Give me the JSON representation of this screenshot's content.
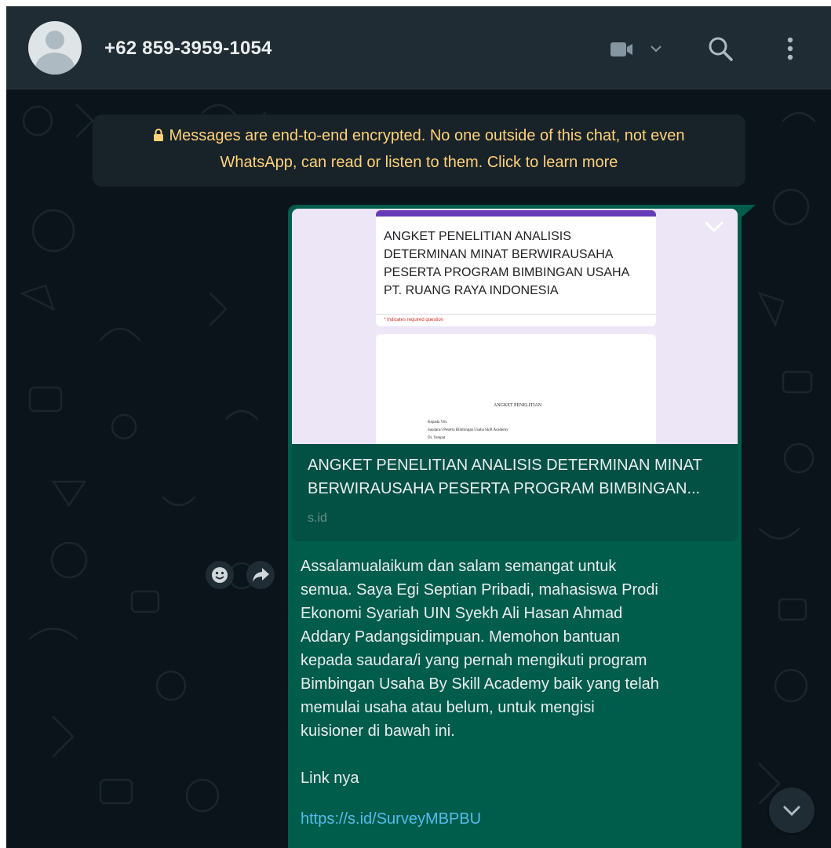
{
  "header": {
    "contact_name": "+62 859-3959-1054",
    "icons": [
      "default-avatar-icon",
      "video-call-icon",
      "chevron-down-icon",
      "search-icon",
      "menu-dots-icon"
    ]
  },
  "encryption_notice": {
    "line1": "Messages are end-to-end encrypted. No one outside of this chat, not even",
    "line2": "WhatsApp, can read or listen to them. Click to learn more",
    "color": "#ffd279"
  },
  "message": {
    "preview": {
      "form_title_lines": [
        "ANGKET PENELITIAN ANALISIS",
        "DETERMINAN MINAT BERWIRAUSAHA",
        "PESERTA PROGRAM BIMBINGAN USAHA",
        "PT. RUANG RAYA INDONESIA"
      ],
      "form_required": "* Indicates required question",
      "doc_heading": "ANGKET PENELITIAN",
      "doc_lines": [
        "Kepada Yth.",
        "Saudara/i Peserta Bimbingan Usaha Skill Academy",
        "Di. Tempat"
      ],
      "title": "ANGKET PENELITIAN ANALISIS DETERMINAN MINAT BERWIRAUSAHA PESERTA PROGRAM BIMBINGAN...",
      "domain": "s.id"
    },
    "body": "Assalamualaikum dan salam semangat untuk\nsemua. Saya Egi Septian Pribadi, mahasiswa Prodi\nEkonomi Syariah UIN Syekh Ali Hasan Ahmad\nAddary Padangsidimpuan. Memohon bantuan\nkepada saudara/i yang pernah mengikuti program\nBimbingan Usaha By Skill Academy baik yang telah\nmemulai usaha atau belum, untuk mengisi\nkuisioner di bawah ini.\n\nLink nya",
    "link": "https://s.id/SurveyMBPBU",
    "bubble_color": "#005c4b",
    "link_color": "#53bdeb"
  },
  "colors": {
    "header_bg": "#202c33",
    "chat_bg": "#0b141a",
    "text": "#e9edef"
  }
}
